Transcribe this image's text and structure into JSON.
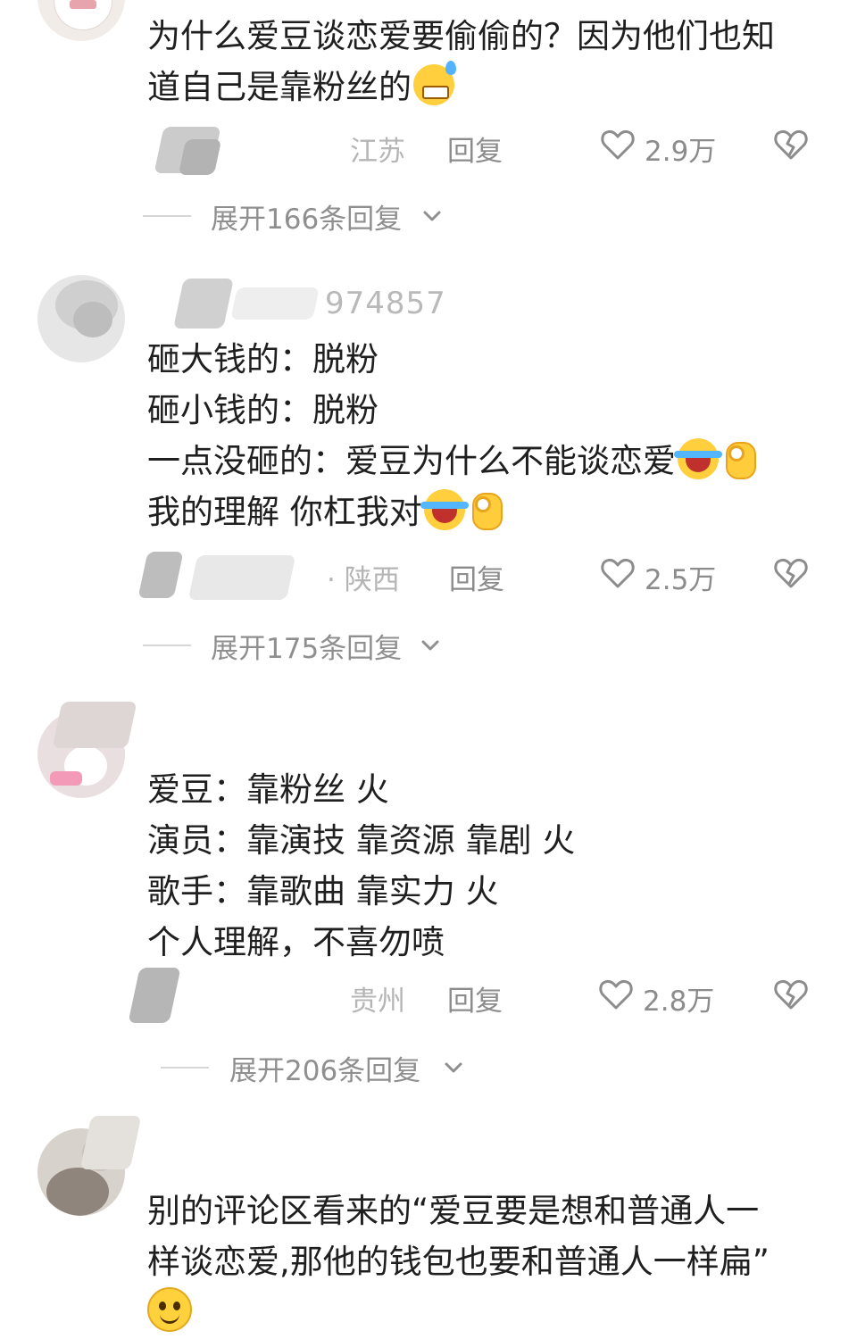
{
  "comments": [
    {
      "username": "",
      "lines": [
        "为什么爱豆谈恋爱要偷偷的？因为他们也知",
        "道自己是靠粉丝的"
      ],
      "location": "江苏",
      "reply_label": "回复",
      "likes": "2.9万",
      "expand_label": "展开166条回复",
      "emoji_line1": "sweat-smile-emoji"
    },
    {
      "username": "974857",
      "lines": [
        "砸大钱的：脱粉",
        "砸小钱的：脱粉",
        "一点没砸的：爱豆为什么不能谈恋爱",
        "我的理解 你杠我对"
      ],
      "location": "· 陕西",
      "reply_label": "回复",
      "likes": "2.5万",
      "expand_label": "展开175条回复"
    },
    {
      "username": "",
      "lines": [
        "爱豆：靠粉丝 火",
        "演员：靠演技 靠资源 靠剧 火",
        "歌手：靠歌曲 靠实力 火",
        "个人理解，不喜勿喷"
      ],
      "location": "贵州",
      "reply_label": "回复",
      "likes": "2.8万",
      "expand_label": "展开206条回复"
    },
    {
      "username": "",
      "lines": [
        "别的评论区看来的“爱豆要是想和普通人一",
        "样谈恋爱,那他的钱包也要和普通人一样扁”"
      ]
    }
  ],
  "icons": {
    "like": "heart-outline-icon",
    "dislike": "broken-heart-icon",
    "expand": "chevron-down-icon"
  },
  "colors": {
    "text": "#1f1f1f",
    "meta": "#8c8c8c",
    "location": "#b5b5b5"
  }
}
